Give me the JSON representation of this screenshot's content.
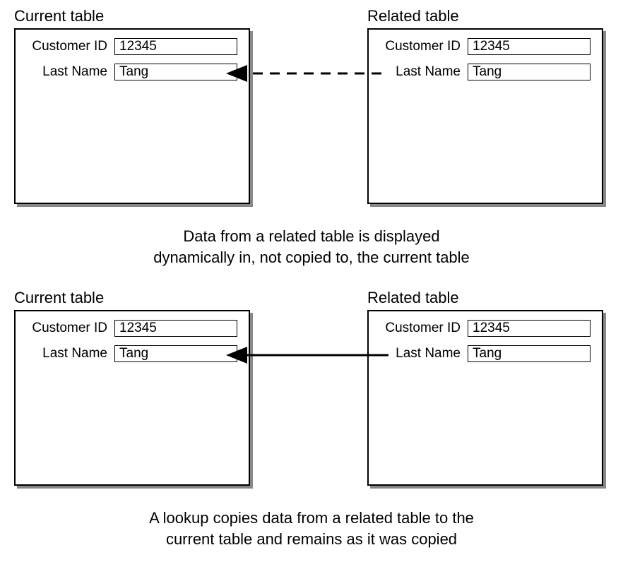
{
  "sections": [
    {
      "left_title": "Current table",
      "right_title": "Related table",
      "left_fields": [
        {
          "label": "Customer ID",
          "value": "12345"
        },
        {
          "label": "Last Name",
          "value": "Tang"
        }
      ],
      "right_fields": [
        {
          "label": "Customer ID",
          "value": "12345"
        },
        {
          "label": "Last Name",
          "value": "Tang"
        }
      ],
      "arrow_style": "dashed",
      "caption": "Data from a related table is displayed\ndynamically in, not copied to, the current table"
    },
    {
      "left_title": "Current table",
      "right_title": "Related table",
      "left_fields": [
        {
          "label": "Customer ID",
          "value": "12345"
        },
        {
          "label": "Last Name",
          "value": "Tang"
        }
      ],
      "right_fields": [
        {
          "label": "Customer ID",
          "value": "12345"
        },
        {
          "label": "Last Name",
          "value": "Tang"
        }
      ],
      "arrow_style": "solid",
      "caption": "A lookup copies data from a related table to the\ncurrent table and remains as it was copied"
    }
  ]
}
